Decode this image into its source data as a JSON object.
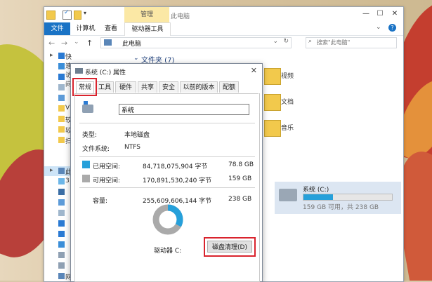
{
  "quick_access_toolbar": {
    "dropdown_glyph": "▾"
  },
  "title_bar": {
    "context_tab": "管理",
    "title": "此电脑",
    "minimize": "—",
    "maximize": "☐",
    "close": "✕"
  },
  "ribbon": {
    "tabs": [
      "文件",
      "计算机",
      "查看",
      "驱动器工具"
    ],
    "expand": "⌄",
    "help": "?"
  },
  "nav": {
    "back": "←",
    "forward": "→",
    "recent": "⌄",
    "up": "↑",
    "address": "此电脑",
    "address_dropdown": "⌄",
    "refresh": "↻",
    "search_placeholder": "搜索\"此电脑\""
  },
  "sidebar": {
    "expander": "▸",
    "items": [
      {
        "label": "快速访问",
        "icon": "star-icon"
      },
      {
        "label": "",
        "icon": "desktop-icon"
      },
      {
        "label": "",
        "icon": "download-icon"
      },
      {
        "label": "",
        "icon": "document-icon"
      },
      {
        "label": "",
        "icon": "picture-icon"
      },
      {
        "label": "V",
        "icon": "folder-icon"
      },
      {
        "label": "较",
        "icon": "folder-icon"
      },
      {
        "label": "较",
        "icon": "folder-icon"
      },
      {
        "label": "扫",
        "icon": "folder-icon"
      },
      {
        "label": "此",
        "icon": "this-pc-icon"
      },
      {
        "label": "3",
        "icon": "3d-objects-icon"
      },
      {
        "label": "",
        "icon": "video-icon"
      },
      {
        "label": "",
        "icon": "picture-icon"
      },
      {
        "label": "",
        "icon": "document-icon"
      },
      {
        "label": "",
        "icon": "download-icon"
      },
      {
        "label": "",
        "icon": "music-icon"
      },
      {
        "label": "",
        "icon": "desktop-icon"
      },
      {
        "label": "",
        "icon": "drive-icon"
      },
      {
        "label": "",
        "icon": "drive-icon"
      },
      {
        "label": "网",
        "icon": "network-icon"
      }
    ]
  },
  "content": {
    "group_chevron": "⌄",
    "group_header": "文件夹 (7)",
    "folders": [
      {
        "label": "视频",
        "icon": "video-folder-icon"
      },
      {
        "label": "文档",
        "icon": "document-folder-icon"
      },
      {
        "label": "音乐",
        "icon": "music-folder-icon"
      }
    ],
    "drive": {
      "name": "系统 (C:)",
      "free_text": "159 GB 可用，共 238 GB",
      "used_fraction": 0.33
    }
  },
  "dialog": {
    "title": "系统 (C:) 属性",
    "close": "✕",
    "tabs": [
      "常规",
      "工具",
      "硬件",
      "共享",
      "安全",
      "以前的版本",
      "配额"
    ],
    "active_tab": "常规",
    "drive_name": "系统",
    "type_label": "类型:",
    "type_value": "本地磁盘",
    "fs_label": "文件系统:",
    "fs_value": "NTFS",
    "used_label": "已用空间:",
    "used_bytes": "84,718,075,904 字节",
    "used_gb": "78.8 GB",
    "free_label": "可用空间:",
    "free_bytes": "170,891,530,240 字节",
    "free_gb": "159 GB",
    "capacity_label": "容量:",
    "capacity_bytes": "255,609,606,144 字节",
    "capacity_gb": "238 GB",
    "drive_label": "驱动器 C:",
    "cleanup_button": "磁盘清理(D)",
    "used_color": "#26a0da",
    "free_color": "#aaaaaa",
    "used_fraction": 0.331
  },
  "highlight_color": "#d9232d"
}
